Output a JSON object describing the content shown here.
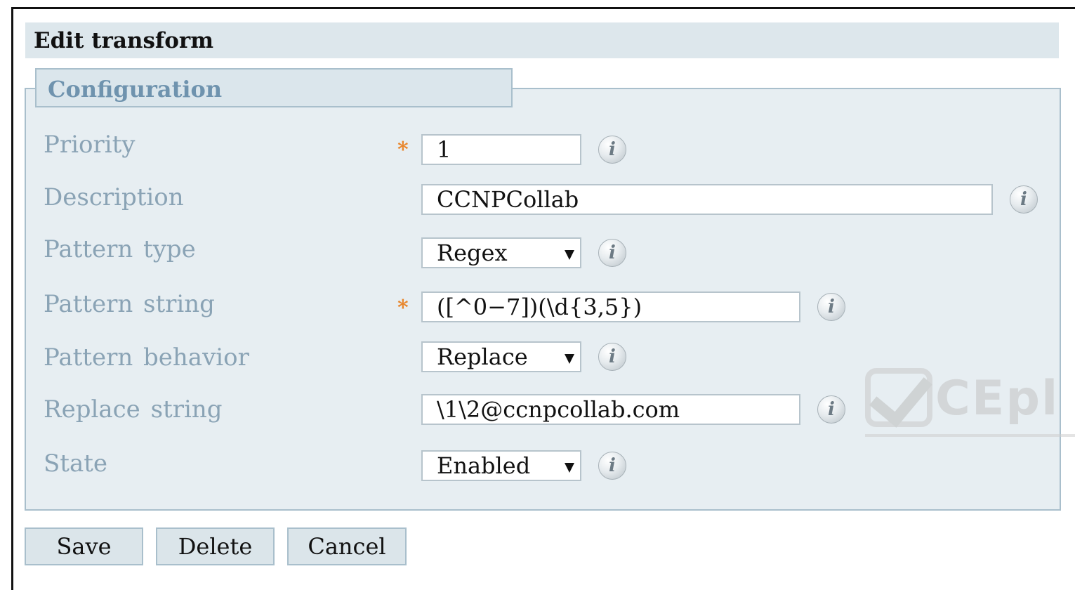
{
  "panel": {
    "title": "Edit transform"
  },
  "section": {
    "legend": "Configuration"
  },
  "fields": {
    "priority": {
      "label": "Priority",
      "value": "1",
      "required": "*"
    },
    "description": {
      "label": "Description",
      "value": "CCNPCollab"
    },
    "pattern_type": {
      "label": "Pattern  type",
      "value": "Regex"
    },
    "pattern_string": {
      "label": "Pattern  string",
      "value": "([^0−7])(\\d{3,5})",
      "required": "*"
    },
    "pattern_behavior": {
      "label": "Pattern  behavior",
      "value": "Replace"
    },
    "replace_string": {
      "label": "Replace string",
      "value": "\\1\\2@ccnpcollab.com"
    },
    "state": {
      "label": "State",
      "value": "Enabled"
    }
  },
  "info_glyph": "i",
  "buttons": {
    "save": "Save",
    "delete": "Delete",
    "cancel": "Cancel"
  },
  "watermark": {
    "text": "CEpl"
  },
  "colors": {
    "required_asterisk": "#e8862c",
    "label": "#8aa3b5",
    "legend": "#6f93ae",
    "panel_bg": "#e7eef2"
  }
}
